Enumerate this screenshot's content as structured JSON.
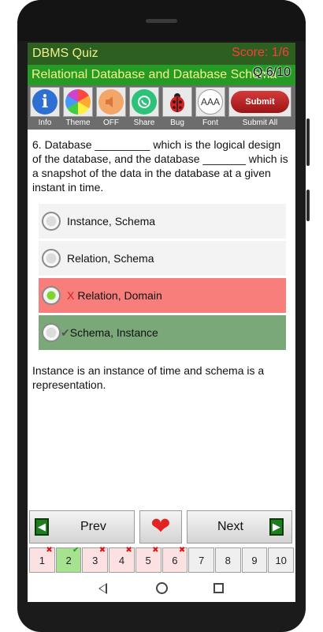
{
  "header": {
    "app_title": "DBMS Quiz",
    "score": "Score: 1/6",
    "chapter": "Relational Database and Database Schema",
    "question_counter": "Q.6/10"
  },
  "toolbar": {
    "items": [
      {
        "label": "Info",
        "icon": "info-icon"
      },
      {
        "label": "Theme",
        "icon": "theme-icon"
      },
      {
        "label": "OFF",
        "icon": "sound-icon"
      },
      {
        "label": "Share",
        "icon": "share-icon"
      },
      {
        "label": "Bug",
        "icon": "ladybug-icon"
      },
      {
        "label": "Font",
        "icon": "font-size-icon"
      },
      {
        "label": "Submit All",
        "icon": "submit-icon"
      }
    ],
    "submit_button": "Submit",
    "font_icon_text": "AAA"
  },
  "question": {
    "text": "6. Database _________ which is the logical design of the database, and the database _______ which is a snapshot of the data in the database at a given instant in time."
  },
  "options": [
    {
      "text": "Instance, Schema",
      "state": "normal"
    },
    {
      "text": "Relation, Schema",
      "state": "normal"
    },
    {
      "text": "Relation, Domain",
      "state": "wrong",
      "mark": "X"
    },
    {
      "text": "Schema, Instance",
      "state": "correct",
      "mark": "✔"
    }
  ],
  "explanation": "Instance is an instance of time and schema is a representation.",
  "navigation": {
    "prev_label": "Prev",
    "next_label": "Next"
  },
  "question_grid": [
    {
      "num": "1",
      "status": "wrong"
    },
    {
      "num": "2",
      "status": "correct"
    },
    {
      "num": "3",
      "status": "wrong"
    },
    {
      "num": "4",
      "status": "wrong"
    },
    {
      "num": "5",
      "status": "wrong"
    },
    {
      "num": "6",
      "status": "wrong"
    },
    {
      "num": "7",
      "status": "none"
    },
    {
      "num": "8",
      "status": "none"
    },
    {
      "num": "9",
      "status": "none"
    },
    {
      "num": "10",
      "status": "none"
    }
  ],
  "colors": {
    "title_bar": "#2d5f20",
    "subtitle_bar": "#259b25",
    "score": "#ff3b3b",
    "wrong_option": "#f87e7b",
    "correct_option": "#7aa879"
  }
}
